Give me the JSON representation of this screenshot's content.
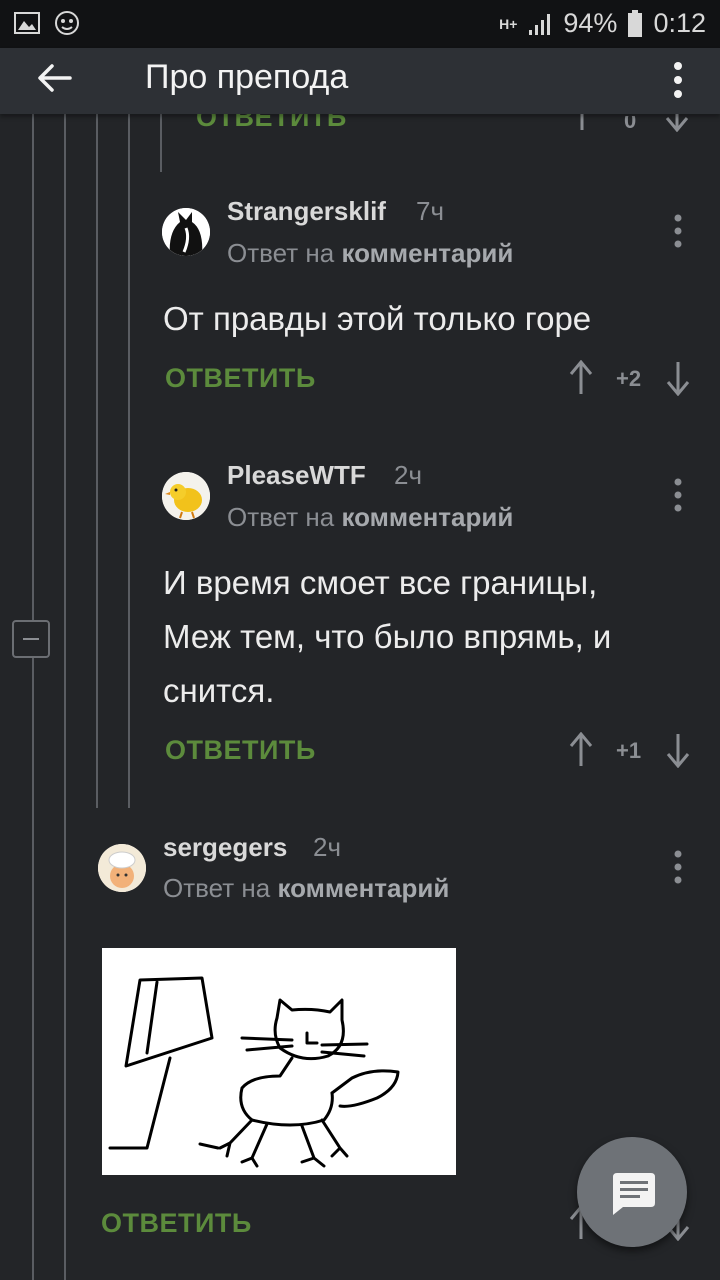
{
  "status_bar": {
    "battery": "94%",
    "time": "0:12",
    "network": "H+"
  },
  "app_bar": {
    "title": "Про препода"
  },
  "reply_label": "ОТВЕТИТЬ",
  "top_partial": {
    "reply_label": "ОТВЕТИТЬ",
    "score": "0"
  },
  "comments": [
    {
      "username": "Strangersklif",
      "time": "7ч",
      "reply_prefix": "Ответ на",
      "reply_target": "комментарий",
      "text": "От правды этой только горе",
      "score": "+2",
      "avatar": "black-cat-avatar"
    },
    {
      "username": "PleaseWTF",
      "time": "2ч",
      "reply_prefix": "Ответ на",
      "reply_target": "комментарий",
      "text_lines": [
        "И время смоет все границы,",
        "Меж тем, что было впрямь, и",
        "снится."
      ],
      "score": "+1",
      "avatar": "chick-avatar"
    },
    {
      "username": "sergegers",
      "time": "2ч",
      "reply_prefix": "Ответ на",
      "reply_target": "комментарий",
      "image": "hand-drawn lamp and cat",
      "avatar": "chef-avatar"
    }
  ],
  "colors": {
    "background": "#232528",
    "appbar": "#2d3035",
    "accent_green": "#5c8b3c",
    "muted": "#8b8e93"
  }
}
